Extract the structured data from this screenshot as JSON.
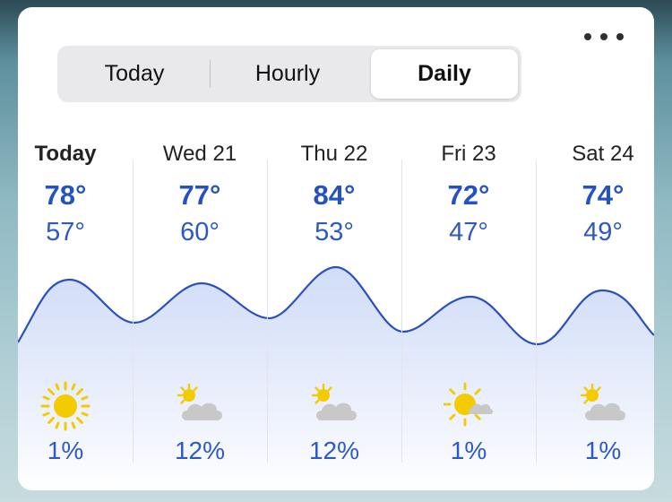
{
  "tabs": [
    {
      "label": "Today",
      "active": false
    },
    {
      "label": "Hourly",
      "active": false
    },
    {
      "label": "Daily",
      "active": true
    }
  ],
  "days": [
    {
      "day": "Today",
      "high": "78°",
      "low": "57°",
      "precip": "1%",
      "icon": "sun-icon"
    },
    {
      "day": "Wed 21",
      "high": "77°",
      "low": "60°",
      "precip": "12%",
      "icon": "partly-cloudy-icon"
    },
    {
      "day": "Thu 22",
      "high": "84°",
      "low": "53°",
      "precip": "12%",
      "icon": "partly-cloudy-icon"
    },
    {
      "day": "Fri 23",
      "high": "72°",
      "low": "47°",
      "precip": "1%",
      "icon": "mostly-sunny-icon"
    },
    {
      "day": "Sat 24",
      "high": "74°",
      "low": "49°",
      "precip": "1%",
      "icon": "partly-cloudy-icon"
    }
  ],
  "colors": {
    "accent": "#2451c4",
    "curve": "#2a4fc0",
    "sun": "#f2cb00",
    "cloud": "#c8c8c8"
  }
}
